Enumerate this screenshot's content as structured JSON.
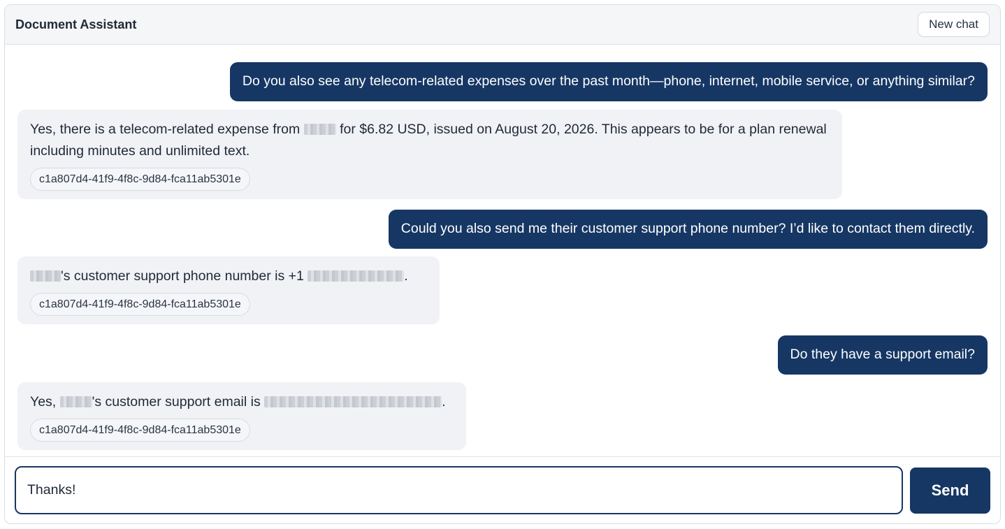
{
  "header": {
    "title": "Document Assistant",
    "new_chat_label": "New chat"
  },
  "messages": [
    {
      "role": "user",
      "text": "Do you also see any telecom-related expenses over the past month—phone, internet, mobile service, or anything similar?"
    },
    {
      "role": "assistant",
      "text_before": "Yes, there is a telecom-related expense from ",
      "text_after": " for $6.82 USD, issued on August 20, 2026. This appears to be for a plan renewal including minutes and unlimited text.",
      "citation": "c1a807d4-41f9-4f8c-9d84-fca11ab5301e"
    },
    {
      "role": "user",
      "text": "Could you also send me their customer support phone number? I’d like to contact them directly."
    },
    {
      "role": "assistant",
      "text_middle": "'s customer support phone number is +1 ",
      "text_end": ".",
      "citation": "c1a807d4-41f9-4f8c-9d84-fca11ab5301e"
    },
    {
      "role": "user",
      "text": "Do they have a support email?"
    },
    {
      "role": "assistant",
      "text_start": "Yes, ",
      "text_middle": "'s customer support email is ",
      "text_end": ".",
      "citation": "c1a807d4-41f9-4f8c-9d84-fca11ab5301e"
    }
  ],
  "composer": {
    "value": "Thanks!",
    "send_label": "Send"
  },
  "colors": {
    "accent": "#163764",
    "assistant_bubble": "#f1f2f6",
    "header_bg": "#f5f6f8"
  }
}
